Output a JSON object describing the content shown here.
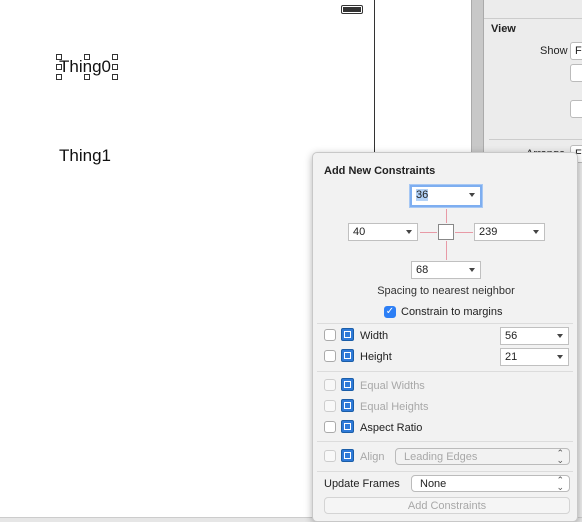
{
  "canvas": {
    "labels": [
      "Thing0",
      "Thing1"
    ]
  },
  "inspector": {
    "section": "View",
    "show_label": "Show",
    "show_value": "F",
    "arrange_label": "Arrange",
    "arrange_value": "F"
  },
  "popover": {
    "title": "Add New Constraints",
    "top": "36",
    "left": "40",
    "right": "239",
    "bottom": "68",
    "spacing_label": "Spacing to nearest neighbor",
    "constrain_margins": {
      "label": "Constrain to margins",
      "checked": true
    },
    "width": {
      "label": "Width",
      "value": "56",
      "checked": false
    },
    "height": {
      "label": "Height",
      "value": "21",
      "checked": false
    },
    "equal_widths": {
      "label": "Equal Widths",
      "enabled": false
    },
    "equal_heights": {
      "label": "Equal Heights",
      "enabled": false
    },
    "aspect_ratio": {
      "label": "Aspect Ratio",
      "checked": false
    },
    "align": {
      "label": "Align",
      "value": "Leading Edges",
      "enabled": false
    },
    "update_frames": {
      "label": "Update Frames",
      "value": "None"
    },
    "add_button": "Add Constraints",
    "accent": "#2d7ff5"
  }
}
